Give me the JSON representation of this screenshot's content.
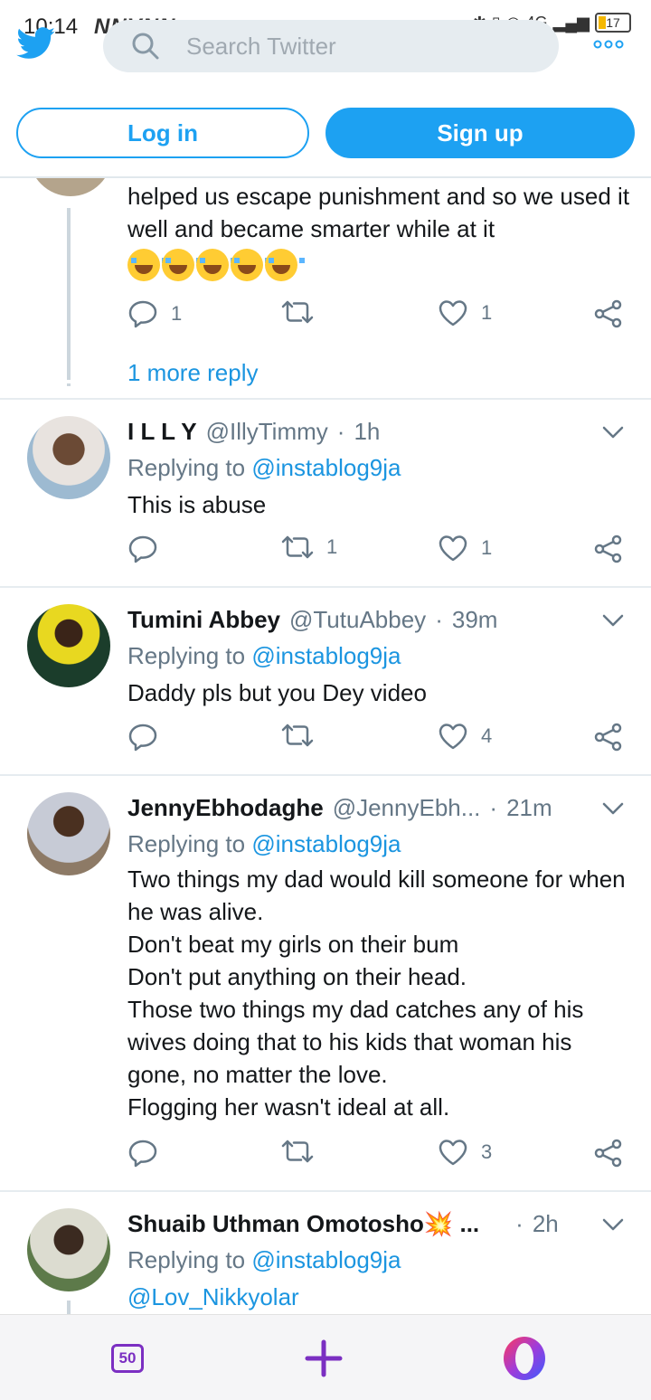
{
  "status_bar": {
    "time": "10:14",
    "carriers": "NNVNN",
    "battery": "17",
    "network": "4G"
  },
  "header": {
    "search_placeholder": "Search Twitter",
    "login_label": "Log in",
    "signup_label": "Sign up"
  },
  "colors": {
    "accent": "#1da1f2",
    "link": "#1b95e0",
    "muted": "#657786",
    "opera": "#7b2fc2"
  },
  "thread_top": {
    "text": "helped us escape punishment and so we used it well and became smarter while at it",
    "reply_count": "1",
    "like_count": "1",
    "more_reply_label": "1 more reply"
  },
  "tweets": [
    {
      "name": "I L L Y",
      "handle": "@IllyTimmy",
      "time": "1h",
      "replying_prefix": "Replying to",
      "replying_to": "@instablog9ja",
      "text": "This is abuse",
      "reply_count": "",
      "retweet_count": "1",
      "like_count": "1"
    },
    {
      "name": "Tumini Abbey",
      "handle": "@TutuAbbey",
      "time": "39m",
      "replying_prefix": "Replying to",
      "replying_to": "@instablog9ja",
      "text": "Daddy pls but you Dey video",
      "reply_count": "",
      "retweet_count": "",
      "like_count": "4"
    },
    {
      "name": "JennyEbhodaghe",
      "handle": "@JennyEbh...",
      "time": "21m",
      "replying_prefix": "Replying to",
      "replying_to": "@instablog9ja",
      "text": "Two things my dad would kill someone for when he was alive.\nDon't beat my girls  on their bum\nDon't put anything on their head.\nThose two things my dad catches any of his wives doing that to his kids that woman his gone, no matter the love.\nFlogging her wasn't ideal at all.",
      "reply_count": "",
      "retweet_count": "",
      "like_count": "3"
    },
    {
      "name": "Shuaib Uthman Omotosho💥 ...",
      "handle": "",
      "time": "2h",
      "replying_prefix": "Replying to",
      "replying_to": "@instablog9ja",
      "text": "@Lov_Nikkyolar"
    }
  ],
  "bottom_bar": {
    "tab_count": "50"
  }
}
